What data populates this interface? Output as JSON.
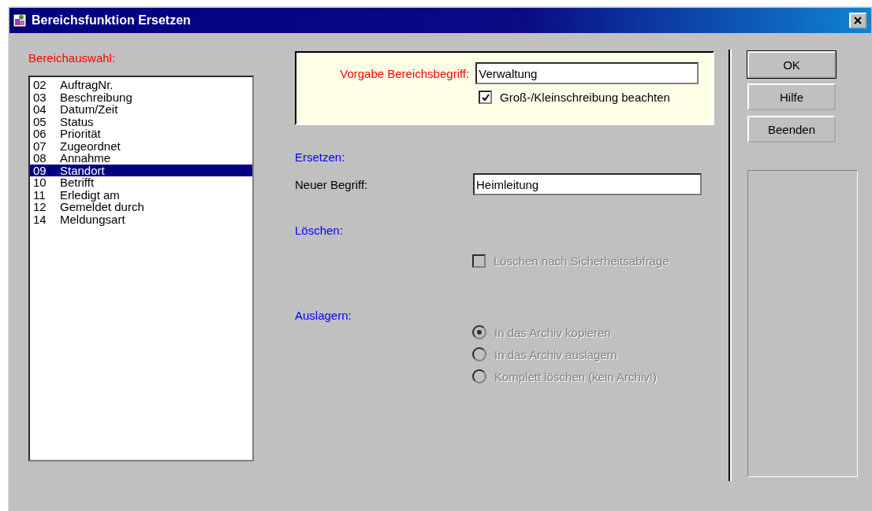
{
  "window": {
    "title": "Bereichsfunktion Ersetzen"
  },
  "area_list": {
    "label": "Bereichauswahl:",
    "items": [
      {
        "number": "02",
        "name": "AuftragNr.",
        "selected": false
      },
      {
        "number": "03",
        "name": "Beschreibung",
        "selected": false
      },
      {
        "number": "04",
        "name": "Datum/Zeit",
        "selected": false
      },
      {
        "number": "05",
        "name": "Status",
        "selected": false
      },
      {
        "number": "06",
        "name": "Priorität",
        "selected": false
      },
      {
        "number": "07",
        "name": "Zugeordnet",
        "selected": false
      },
      {
        "number": "08",
        "name": "Annahme",
        "selected": false
      },
      {
        "number": "09",
        "name": "Standort",
        "selected": true
      },
      {
        "number": "10",
        "name": "Betrifft",
        "selected": false
      },
      {
        "number": "11",
        "name": "Erledigt am",
        "selected": false
      },
      {
        "number": "12",
        "name": "Gemeldet durch",
        "selected": false
      },
      {
        "number": "14",
        "name": "Meldungsart",
        "selected": false
      }
    ]
  },
  "search": {
    "label": "Vorgabe Bereichsbegriff:",
    "value": "Verwaltung",
    "match_case": {
      "label": "Groß-/Kleinschreibung beachten",
      "checked": true,
      "disabled": false
    }
  },
  "replace": {
    "heading": "Ersetzen:",
    "label": "Neuer Begriff:",
    "value": "Heimleitung"
  },
  "delete": {
    "heading": "Löschen:",
    "confirm": {
      "label": "Löschen nach Sicherheitsabfrage",
      "checked": false,
      "disabled": true
    }
  },
  "archive": {
    "heading": "Auslagern:",
    "disabled": true,
    "options": [
      {
        "label": "In das Archiv kopieren",
        "selected": true
      },
      {
        "label": "In das Archiv auslagern",
        "selected": false
      },
      {
        "label": "Komplett löschen (kein Archiv!)",
        "selected": false
      }
    ]
  },
  "buttons": [
    {
      "label": "OK",
      "default": true
    },
    {
      "label": "Hilfe",
      "default": false
    },
    {
      "label": "Beenden",
      "default": false
    }
  ]
}
